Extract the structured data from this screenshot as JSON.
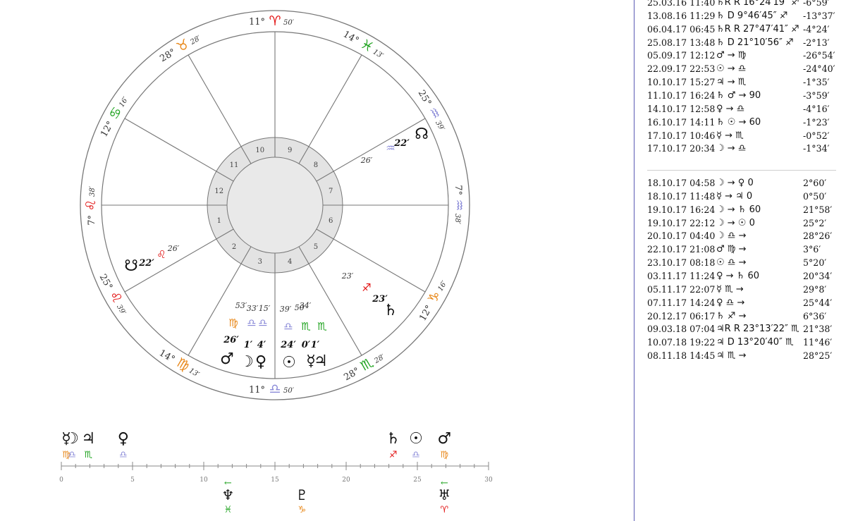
{
  "colors": {
    "fire": "#e21010",
    "earth": "#e8881a",
    "air": "#8a8ad8",
    "water": "#1fa31f",
    "wheel": "#777777",
    "inner_fill": "#e3e3e3",
    "center_fill": "#e9e9e9",
    "divider": "#5a5ab4"
  },
  "wheel": {
    "houses": [
      "1",
      "2",
      "3",
      "4",
      "5",
      "6",
      "7",
      "8",
      "9",
      "10",
      "11",
      "12"
    ],
    "cusps": [
      {
        "d": "11°",
        "s": "♈",
        "m": "50′",
        "color": "fire"
      },
      {
        "d": "14°",
        "s": "♓",
        "m": "13′",
        "color": "water"
      },
      {
        "d": "25°",
        "s": "♒",
        "m": "39′",
        "color": "air"
      },
      {
        "d": "7°",
        "s": "♒",
        "m": "38′",
        "color": "air"
      },
      {
        "d": "12°",
        "s": "♑",
        "m": "16′",
        "color": "earth"
      },
      {
        "d": "28°",
        "s": "♏",
        "m": "28′",
        "color": "water"
      },
      {
        "d": "11°",
        "s": "♎",
        "m": "50′",
        "color": "air"
      },
      {
        "d": "14°",
        "s": "♍",
        "m": "13′",
        "color": "earth"
      },
      {
        "d": "25°",
        "s": "♌",
        "m": "39′",
        "color": "fire"
      },
      {
        "d": "7°",
        "s": "♌",
        "m": "38′",
        "color": "fire"
      },
      {
        "d": "12°",
        "s": "♋",
        "m": "16′",
        "color": "water"
      },
      {
        "d": "28°",
        "s": "♉",
        "m": "28′",
        "color": "earth"
      }
    ],
    "planets": [
      {
        "glyph": "☊",
        "deg": "22′",
        "sign": "♒",
        "signColor": "air",
        "min": "26′"
      },
      {
        "glyph": "☋",
        "deg": "22′",
        "sign": "♌",
        "signColor": "fire",
        "min": "26′"
      },
      {
        "glyph": "♄",
        "deg": "23′",
        "sign": "♐",
        "signColor": "fire",
        "min": "23′"
      },
      {
        "glyph": "♂",
        "deg": "26′",
        "sign": "♍",
        "signColor": "earth",
        "min": "53′"
      },
      {
        "glyph": "☽",
        "deg": "1′",
        "sign": "♎",
        "signColor": "air",
        "min": "33′"
      },
      {
        "glyph": "♀",
        "deg": "4′",
        "sign": "♎",
        "signColor": "air",
        "min": "15′"
      },
      {
        "glyph": "☉",
        "deg": "24′",
        "sign": "♎",
        "signColor": "air",
        "min": "39′"
      },
      {
        "glyph": "☿",
        "deg": "0′",
        "sign": "♏",
        "signColor": "water",
        "min": "50′"
      },
      {
        "glyph": "♃",
        "deg": "1′",
        "sign": "♏",
        "signColor": "water",
        "min": "34′"
      }
    ]
  },
  "scale": {
    "ticks": [
      "0",
      "5",
      "10",
      "15",
      "20",
      "25",
      "30"
    ],
    "top": [
      {
        "at": 0.35,
        "glyph": "☿",
        "sign": "♍",
        "signColor": "earth"
      },
      {
        "at": 0.75,
        "glyph": "☽",
        "sign": "♎",
        "signColor": "air"
      },
      {
        "at": 1.9,
        "glyph": "♃",
        "sign": "♏",
        "signColor": "water"
      },
      {
        "at": 4.35,
        "glyph": "♀",
        "sign": "♎",
        "signColor": "air"
      },
      {
        "at": 23.3,
        "glyph": "♄",
        "sign": "♐",
        "signColor": "fire"
      },
      {
        "at": 24.9,
        "glyph": "☉",
        "sign": "♎",
        "signColor": "air"
      },
      {
        "at": 26.9,
        "glyph": "♂",
        "sign": "♍",
        "signColor": "earth"
      }
    ],
    "bottom": [
      {
        "at": 11.7,
        "glyph": "♆",
        "sign": "♓",
        "signColor": "water",
        "retro": true
      },
      {
        "at": 16.9,
        "glyph": "♇",
        "sign": "♑",
        "signColor": "earth",
        "retro": false
      },
      {
        "at": 26.9,
        "glyph": "♅",
        "sign": "♈",
        "signColor": "fire",
        "retro": true
      }
    ],
    "retro_arrow": "←"
  },
  "events": [
    {
      "date": "25.03.16 11:40",
      "ev": "♄R R 16°24′19″ ♐",
      "val": "-6°59′"
    },
    {
      "date": "13.08.16 11:29",
      "ev": "♄ D 9°46′45″ ♐",
      "val": "-13°37′"
    },
    {
      "date": "06.04.17 06:45",
      "ev": "♄R R 27°47′41″ ♐",
      "val": "-4°24′"
    },
    {
      "date": "25.08.17 13:48",
      "ev": "♄ D 21°10′56″ ♐",
      "val": "-2°13′"
    },
    {
      "date": "05.09.17 12:12",
      "ev": "♂ → ♍",
      "val": "-26°54′"
    },
    {
      "date": "22.09.17 22:53",
      "ev": "☉ → ♎",
      "val": "-24°40′"
    },
    {
      "date": "10.10.17 15:27",
      "ev": "♃ → ♏",
      "val": "-1°35′"
    },
    {
      "date": "11.10.17 16:24",
      "ev": "♄ ♂ → 90",
      "val": "-3°59′"
    },
    {
      "date": "14.10.17 12:58",
      "ev": "♀ → ♎",
      "val": "-4°16′"
    },
    {
      "date": "16.10.17 14:11",
      "ev": "♄ ☉ → 60",
      "val": "-1°23′"
    },
    {
      "date": "17.10.17 10:46",
      "ev": "☿ → ♏",
      "val": "-0°52′"
    },
    {
      "date": "17.10.17 20:34",
      "ev": "☽ → ♎",
      "val": "-1°34′"
    },
    {
      "date": "18.10.17 04:58",
      "ev": "☽ → ♀ 0",
      "val": "2°60′"
    },
    {
      "date": "18.10.17 11:48",
      "ev": "☿ → ♃ 0",
      "val": "0°50′"
    },
    {
      "date": "19.10.17 16:24",
      "ev": "☽ → ♄ 60",
      "val": "21°58′"
    },
    {
      "date": "19.10.17 22:12",
      "ev": "☽ → ☉ 0",
      "val": "25°2′"
    },
    {
      "date": "20.10.17 04:40",
      "ev": "☽ ♎ →",
      "val": "28°26′"
    },
    {
      "date": "22.10.17 21:08",
      "ev": "♂ ♍ →",
      "val": "3°6′"
    },
    {
      "date": "23.10.17 08:18",
      "ev": "☉ ♎ →",
      "val": "5°20′"
    },
    {
      "date": "03.11.17 11:24",
      "ev": "♀ → ♄ 60",
      "val": "20°34′"
    },
    {
      "date": "05.11.17 22:07",
      "ev": "☿ ♏ →",
      "val": "29°8′"
    },
    {
      "date": "07.11.17 14:24",
      "ev": "♀ ♎ →",
      "val": "25°44′"
    },
    {
      "date": "20.12.17 06:17",
      "ev": "♄ ♐ →",
      "val": "6°36′"
    },
    {
      "date": "09.03.18 07:04",
      "ev": "♃R R 23°13′22″ ♏",
      "val": "21°38′"
    },
    {
      "date": "10.07.18 19:22",
      "ev": "♃ D 13°20′40″ ♏",
      "val": "11°46′"
    },
    {
      "date": "08.11.18 14:45",
      "ev": "♃ ♏ →",
      "val": "28°25′"
    }
  ]
}
